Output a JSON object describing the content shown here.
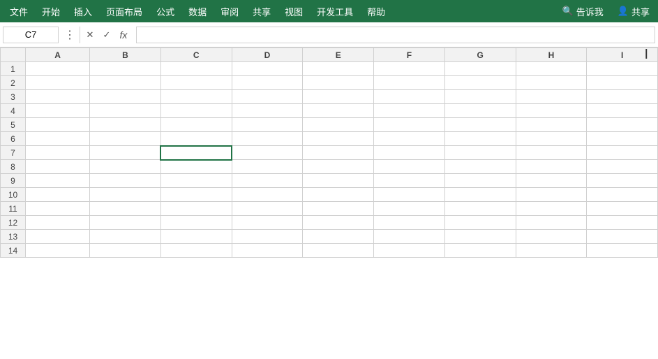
{
  "menubar": {
    "items": [
      {
        "label": "文件",
        "name": "menu-file"
      },
      {
        "label": "开始",
        "name": "menu-home"
      },
      {
        "label": "插入",
        "name": "menu-insert"
      },
      {
        "label": "页面布局",
        "name": "menu-layout"
      },
      {
        "label": "公式",
        "name": "menu-formula"
      },
      {
        "label": "数据",
        "name": "menu-data"
      },
      {
        "label": "审阅",
        "name": "menu-review"
      },
      {
        "label": "共享",
        "name": "menu-share"
      },
      {
        "label": "视图",
        "name": "menu-view"
      },
      {
        "label": "开发工具",
        "name": "menu-developer"
      },
      {
        "label": "帮助",
        "name": "menu-help"
      }
    ],
    "search_label": "告诉我",
    "collab_label": "共享"
  },
  "formulabar": {
    "cell_ref": "C7",
    "cancel_label": "✕",
    "confirm_label": "✓",
    "fx_label": "fx",
    "formula_value": ""
  },
  "grid": {
    "columns": [
      "A",
      "B",
      "C",
      "D",
      "E",
      "F",
      "G",
      "H",
      "I"
    ],
    "rows": 14,
    "selected_cell": {
      "row": 7,
      "col": 2
    }
  }
}
